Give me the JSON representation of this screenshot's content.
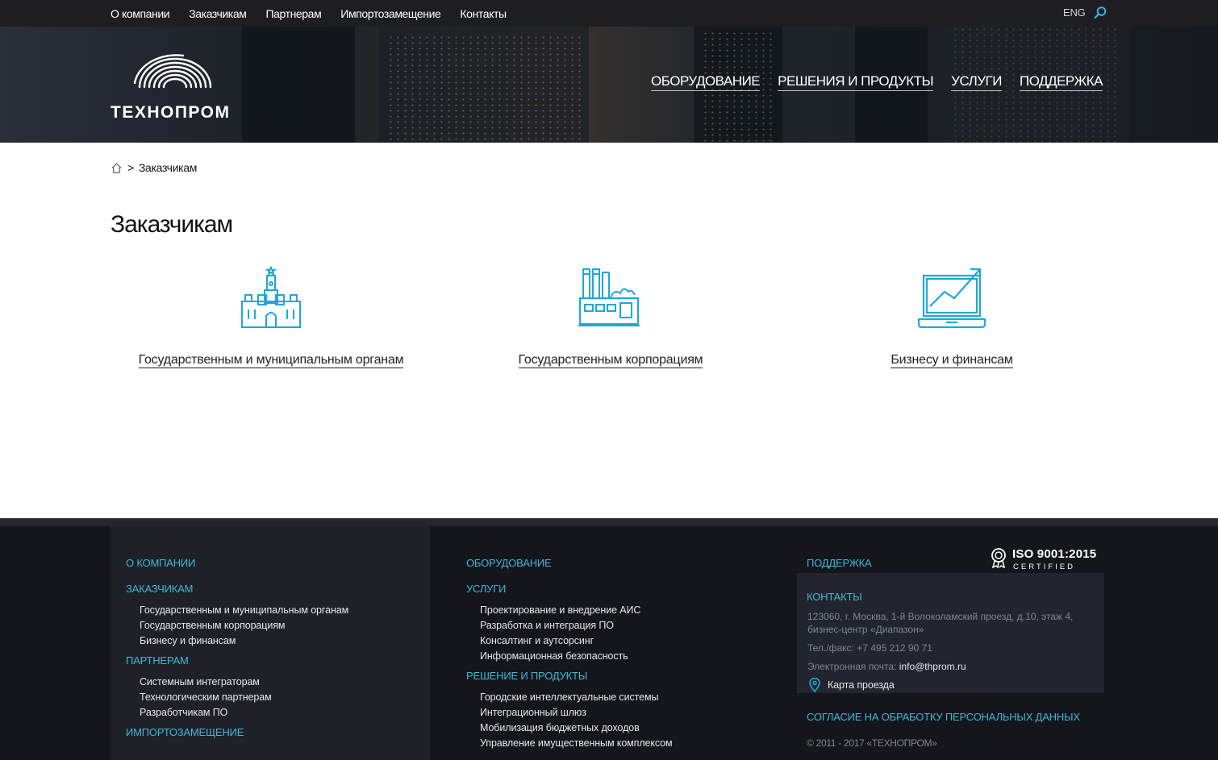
{
  "topbar": {
    "nav": [
      "О компании",
      "Заказчикам",
      "Партнерам",
      "Импортозамещение",
      "Контакты"
    ],
    "lang": "ENG",
    "search_icon": "search-icon"
  },
  "header": {
    "logo_text": "ТЕХНОПРОМ",
    "main_nav": [
      "ОБОРУДОВАНИЕ",
      "РЕШЕНИЯ И ПРОДУКТЫ",
      "УСЛУГИ",
      "ПОДДЕРЖКА"
    ]
  },
  "breadcrumb": {
    "home_icon": "home-icon",
    "separator": ">",
    "current": "Заказчикам"
  },
  "page_title": "Заказчикам",
  "categories": [
    {
      "label": "Государственным и муниципальным органам",
      "icon": "kremlin-icon"
    },
    {
      "label": "Государственным корпорациям",
      "icon": "factory-icon"
    },
    {
      "label": "Бизнесу и финансам",
      "icon": "laptop-chart-icon"
    }
  ],
  "footer": {
    "col1": {
      "about": "О КОМПАНИИ",
      "customers": "ЗАКАЗЧИКАМ",
      "customers_links": [
        "Государственным и муниципальным органам",
        "Государственным корпорациям",
        "Бизнесу и финансам"
      ],
      "partners": "ПАРТНЕРАМ",
      "partners_links": [
        "Системным интеграторам",
        "Технологическим партнерам",
        "Разработчикам ПО"
      ],
      "import": "ИМПОРТОЗАМЕЩЕНИЕ"
    },
    "col2": {
      "equipment": "ОБОРУДОВАНИЕ",
      "services": "УСЛУГИ",
      "services_links": [
        "Проектирование и внедрение АИС",
        "Разработка и интеграция ПО",
        "Консалтинг и аутсорсинг",
        "Информационная безопасность"
      ],
      "solutions": "РЕШЕНИЕ И ПРОДУКТЫ",
      "solutions_links": [
        "Городские интеллектуальные системы",
        "Интеграционный шлюз",
        "Мобилизация бюджетных доходов",
        "Управление имущественным комплексом"
      ]
    },
    "col3": {
      "support": "ПОДДЕРЖКА",
      "iso_title": "ISO 9001:2015",
      "iso_sub": "CERTIFIED",
      "contacts_title": "КОНТАКТЫ",
      "address_line1": "123060, г. Москва, 1-й Волоколамский проезд, д.10, этаж 4,",
      "address_line2": "бизнес-центр «Диапазон»",
      "phone": "Тел./факс: +7 495 212 90 71",
      "email_label": "Электронная почта:",
      "email": "info@thprom.ru",
      "map_link": "Карта проезда",
      "consent": "СОГЛАСИЕ НА ОБРАБОТКУ ПЕРСОНАЛЬНЫХ ДАННЫХ",
      "copyright": "© 2011 - 2017 «ТЕХНОПРОМ»"
    }
  },
  "colors": {
    "accent": "#1ea8d8",
    "footer_head": "#3fb7d6",
    "footer_bg": "#14161c"
  }
}
